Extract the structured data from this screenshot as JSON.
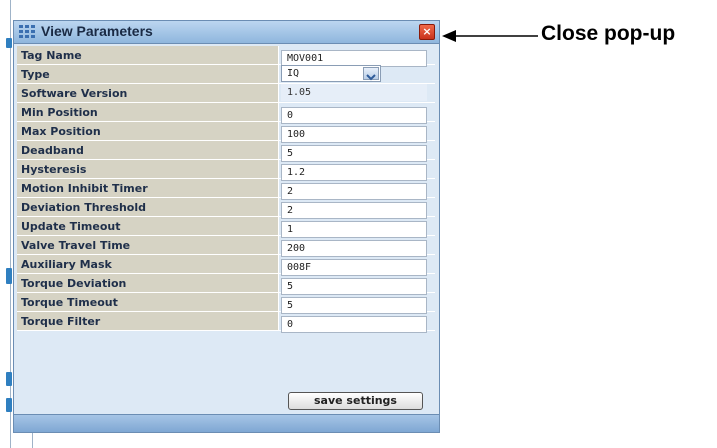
{
  "dialog": {
    "title": "View Parameters",
    "close_symbol": "×",
    "rows": [
      {
        "label": "Tag Name",
        "value": "MOV001",
        "kind": "input"
      },
      {
        "label": "Type",
        "value": "IQ",
        "kind": "select"
      },
      {
        "label": "Software Version",
        "value": "1.05",
        "kind": "readonly"
      },
      {
        "label": "Min Position",
        "value": "0",
        "kind": "input"
      },
      {
        "label": "Max Position",
        "value": "100",
        "kind": "input"
      },
      {
        "label": "Deadband",
        "value": "5",
        "kind": "input"
      },
      {
        "label": "Hysteresis",
        "value": "1.2",
        "kind": "input"
      },
      {
        "label": "Motion Inhibit Timer",
        "value": "2",
        "kind": "input"
      },
      {
        "label": "Deviation Threshold",
        "value": "2",
        "kind": "input"
      },
      {
        "label": "Update Timeout",
        "value": "1",
        "kind": "input"
      },
      {
        "label": "Valve Travel Time",
        "value": "200",
        "kind": "input"
      },
      {
        "label": "Auxiliary Mask",
        "value": "008F",
        "kind": "input"
      },
      {
        "label": "Torque Deviation",
        "value": "5",
        "kind": "input"
      },
      {
        "label": "Torque Timeout",
        "value": "5",
        "kind": "input"
      },
      {
        "label": "Torque Filter",
        "value": "0",
        "kind": "input"
      }
    ],
    "save_label": "save settings"
  },
  "annotation": {
    "text": "Close pop-up"
  },
  "icons": {
    "title": "grid-icon",
    "close": "close-icon",
    "dropdown": "chevron-down-icon"
  },
  "colors": {
    "close_button": "#d9442a",
    "titlebar": "#9fc1e4",
    "label_bg": "#d6d3c4"
  }
}
